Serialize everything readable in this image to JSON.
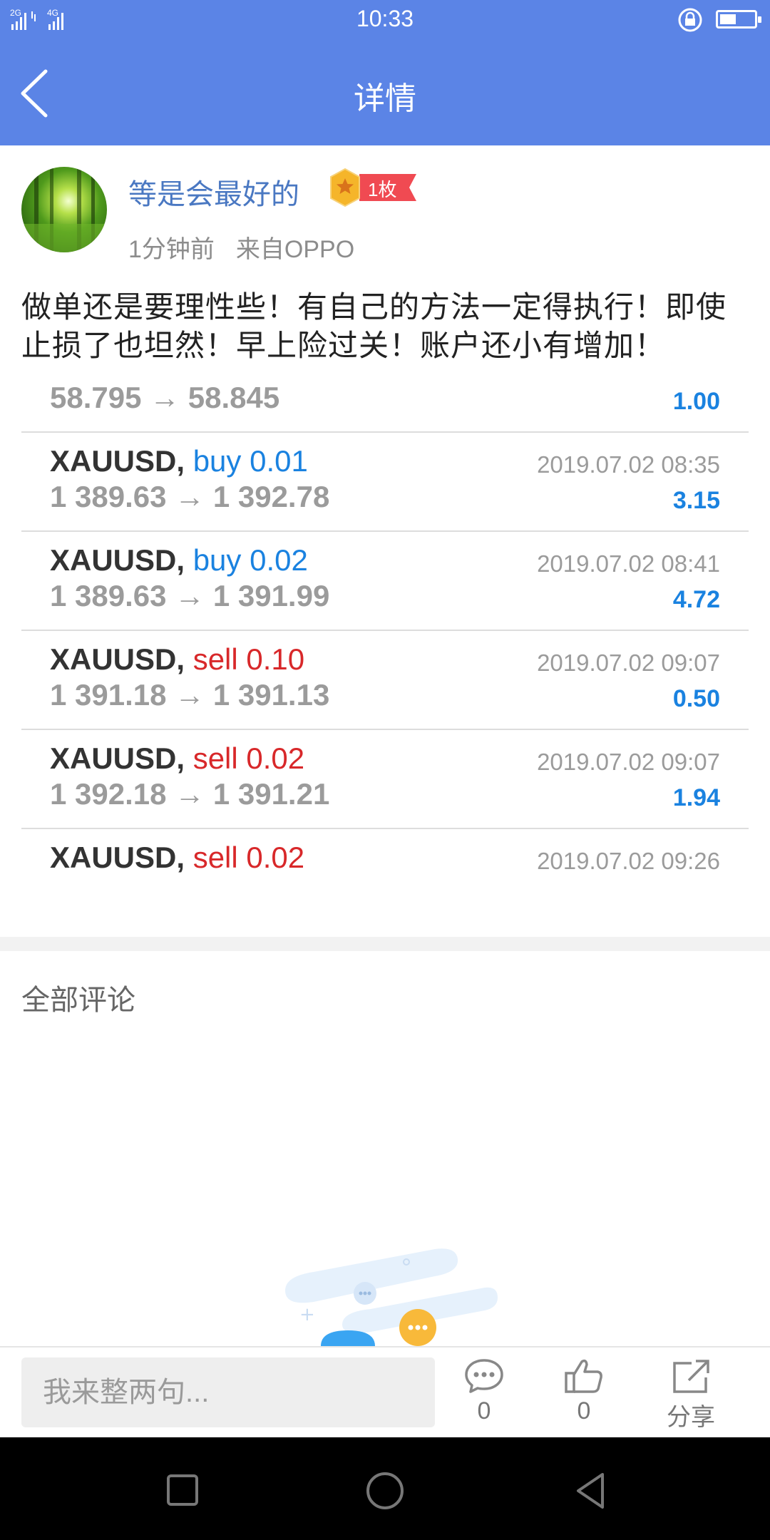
{
  "status_bar": {
    "network": "2G 4G",
    "time": "10:33",
    "battery_level": 0.45
  },
  "header": {
    "title": "详情"
  },
  "post": {
    "author": "等是会最好的",
    "badge": "1枚",
    "time_ago": "1分钟前",
    "source": "来自OPPO",
    "text": "做单还是要理性些！有自己的方法一定得执行！即使止损了也坦然！早上险过关！账户还小有增加！"
  },
  "trades": [
    {
      "symbol": "",
      "side": "",
      "side_type": "",
      "time": "",
      "prices": "58.795 → 58.845",
      "profit": "1.00"
    },
    {
      "symbol": "XAUUSD,",
      "side": "buy 0.01",
      "side_type": "buy",
      "time": "2019.07.02 08:35",
      "prices": "1 389.63 → 1 392.78",
      "profit": "3.15"
    },
    {
      "symbol": "XAUUSD,",
      "side": "buy 0.02",
      "side_type": "buy",
      "time": "2019.07.02 08:41",
      "prices": "1 389.63 → 1 391.99",
      "profit": "4.72"
    },
    {
      "symbol": "XAUUSD,",
      "side": "sell 0.10",
      "side_type": "sell",
      "time": "2019.07.02 09:07",
      "prices": "1 391.18 → 1 391.13",
      "profit": "0.50"
    },
    {
      "symbol": "XAUUSD,",
      "side": "sell 0.02",
      "side_type": "sell",
      "time": "2019.07.02 09:07",
      "prices": "1 392.18 → 1 391.21",
      "profit": "1.94"
    },
    {
      "symbol": "XAUUSD,",
      "side": "sell 0.02",
      "side_type": "sell",
      "time": "2019.07.02 09:26",
      "prices": "",
      "profit": ""
    }
  ],
  "comments": {
    "title": "全部评论"
  },
  "comment_bar": {
    "placeholder": "我来整两句...",
    "comment_count": "0",
    "like_count": "0",
    "share_label": "分享"
  },
  "colors": {
    "header": "#5b84e6",
    "buy": "#1a82e0",
    "sell": "#d8282a",
    "username": "#4a78c2"
  }
}
